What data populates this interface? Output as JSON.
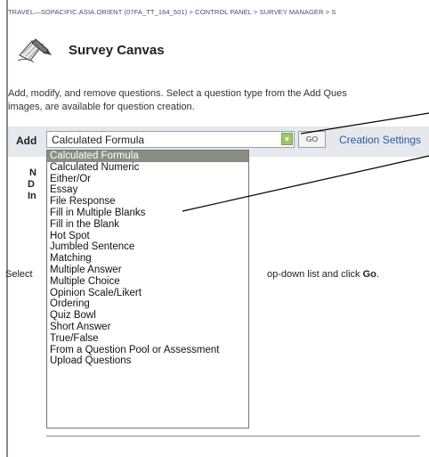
{
  "breadcrumb": "TRAVEL—SOPACIFIC.ASIA.ORIENT (07FA_TT_164_501) > CONTROL PANEL > SURVEY MANAGER > S",
  "page": {
    "icon": "survey-pencil-icon",
    "title": "Survey Canvas",
    "instructions_line1": "Add, modify, and remove questions. Select a question type from the Add Ques",
    "instructions_line2": "images, are available for question creation."
  },
  "add_bar": {
    "label": "Add",
    "selected_value": "Calculated Formula",
    "go_label": "GO",
    "creation_settings": "Creation Settings"
  },
  "background_labels": [
    "N",
    "D",
    "In"
  ],
  "select_hint": {
    "start": "Select",
    "end_prefix": "op-down list and click ",
    "end_bold": "Go",
    "end_suffix": "."
  },
  "dropdown": {
    "items": [
      "Calculated Formula",
      "Calculated Numeric",
      "Either/Or",
      "Essay",
      "File Response",
      "Fill in Multiple Blanks",
      "Fill in the Blank",
      "Hot Spot",
      "Jumbled Sentence",
      "Matching",
      "Multiple Answer",
      "Multiple Choice",
      "Opinion Scale/Likert",
      "Ordering",
      "Quiz Bowl",
      "Short Answer",
      "True/False",
      "From a Question Pool or Assessment",
      "Upload Questions"
    ],
    "highlighted_index": 0
  },
  "colors": {
    "highlight": "#8a8e82",
    "bar": "#e6e8ee",
    "link": "#2a5a9a",
    "arrow_button": "#9cc66e"
  }
}
